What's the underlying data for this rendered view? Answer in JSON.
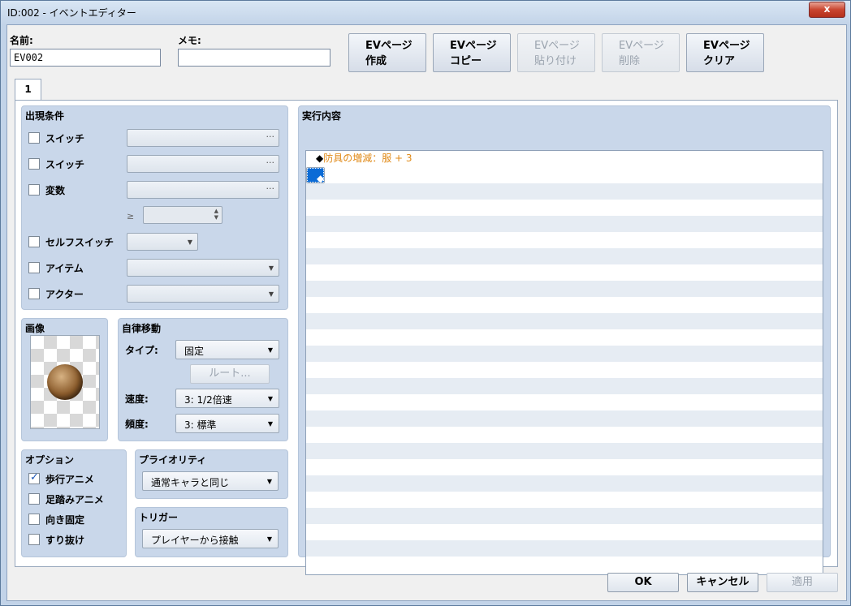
{
  "window": {
    "title": "ID:002 - イベントエディター",
    "close_label": "x"
  },
  "header": {
    "name_label": "名前:",
    "name_value": "EV002",
    "memo_label": "メモ:",
    "memo_value": ""
  },
  "toolbar": {
    "new_line1": "EVページ",
    "new_line2": "作成",
    "copy_line1": "EVページ",
    "copy_line2": "コピー",
    "paste_line1": "EVページ",
    "paste_line2": "貼り付け",
    "delete_line1": "EVページ",
    "delete_line2": "削除",
    "clear_line1": "EVページ",
    "clear_line2": "クリア"
  },
  "tabs": [
    {
      "label": "1"
    }
  ],
  "conditions": {
    "title": "出現条件",
    "switch1": "スイッチ",
    "switch2": "スイッチ",
    "variable": "変数",
    "gte": "≥",
    "self_switch": "セルフスイッチ",
    "item": "アイテム",
    "actor": "アクター",
    "dots": "···"
  },
  "image": {
    "title": "画像"
  },
  "autonomous": {
    "title": "自律移動",
    "type_label": "タイプ:",
    "type_value": "固定",
    "route_button": "ルート...",
    "speed_label": "速度:",
    "speed_value": "3: 1/2倍速",
    "freq_label": "頻度:",
    "freq_value": "3: 標準"
  },
  "options": {
    "title": "オプション",
    "walking": "歩行アニメ",
    "walking_checked": true,
    "stepping": "足踏みアニメ",
    "stepping_checked": false,
    "direction_fix": "向き固定",
    "direction_fix_checked": false,
    "through": "すり抜け",
    "through_checked": false
  },
  "priority": {
    "title": "プライオリティ",
    "value": "通常キャラと同じ"
  },
  "trigger": {
    "title": "トリガー",
    "value": "プレイヤーから接触"
  },
  "contents": {
    "title": "実行内容",
    "commands": [
      {
        "marker": "◆",
        "text": "防具の増減：服 + 3"
      },
      {
        "marker": "◆",
        "text": ""
      }
    ]
  },
  "footer": {
    "ok": "OK",
    "cancel": "キャンセル",
    "apply": "適用"
  }
}
